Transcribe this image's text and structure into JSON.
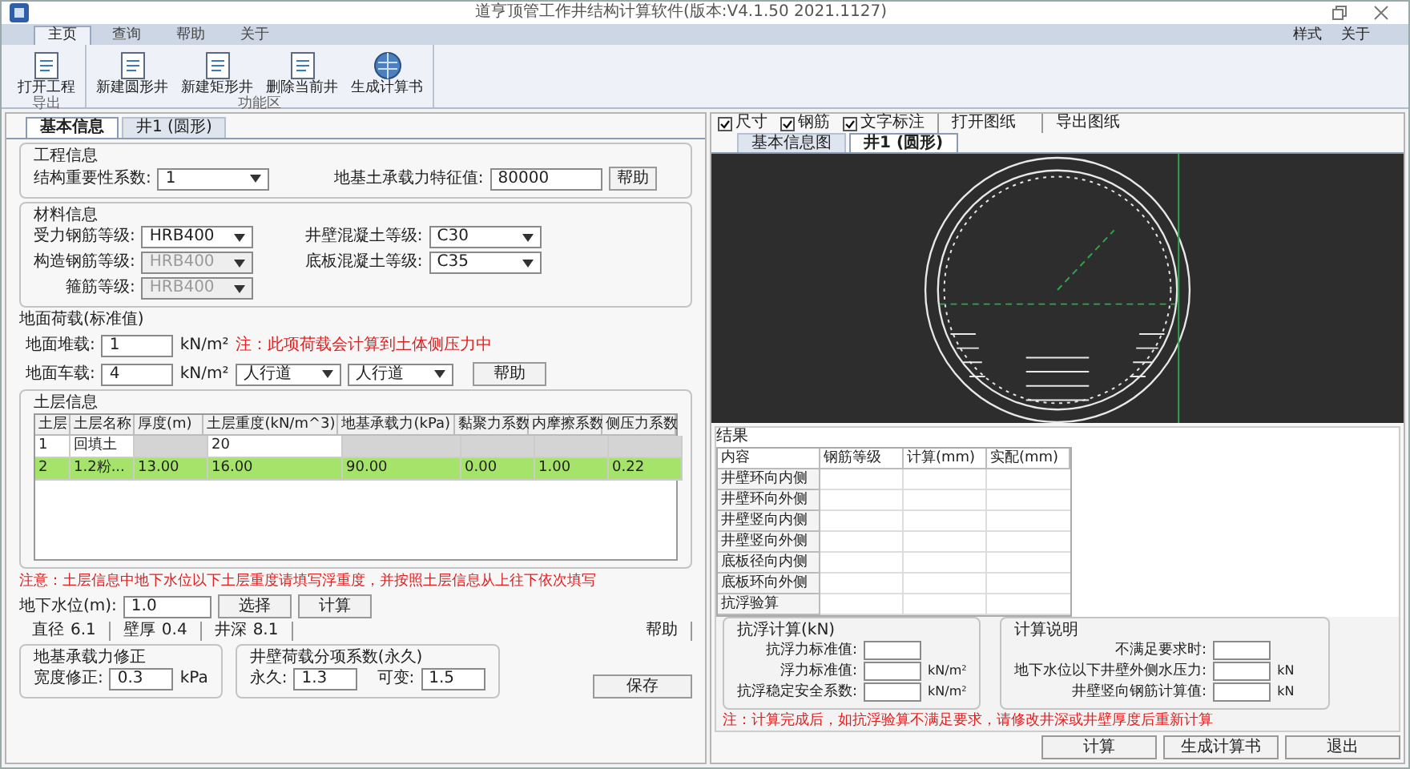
{
  "window": {
    "title": "道亨顶管工作井结构计算软件(版本:V4.1.50 2021.1127)"
  },
  "menu": {
    "tabs": [
      {
        "label": "主页",
        "selected": true
      },
      {
        "label": "查询",
        "selected": false
      },
      {
        "label": "帮助",
        "selected": false
      },
      {
        "label": "关于",
        "selected": false
      }
    ],
    "links": [
      "样式",
      "关于"
    ]
  },
  "ribbon": {
    "groups": [
      {
        "label": "导出",
        "buttons": [
          {
            "label": "打开工程",
            "kind": "doc"
          }
        ]
      },
      {
        "label": "功能区",
        "buttons": [
          {
            "label": "新建圆形井",
            "kind": "doc"
          },
          {
            "label": "新建矩形井",
            "kind": "doc"
          },
          {
            "label": "删除当前井",
            "kind": "doc"
          },
          {
            "label": "生成计算书",
            "kind": "globe"
          }
        ]
      }
    ]
  },
  "left_tabs": [
    {
      "label": "基本信息",
      "selected": true
    },
    {
      "label": "井1 (圆形)",
      "selected": false
    }
  ],
  "project": {
    "title": "工程信息",
    "fields": [
      {
        "kind": "select",
        "label": "结构重要性系数:",
        "value": "1",
        "disabled": false
      },
      {
        "kind": "input",
        "label": "地基土承载力特征值:",
        "value": "80000",
        "button": "帮助"
      }
    ]
  },
  "materials": {
    "title": "材料信息",
    "left": [
      {
        "kind": "select",
        "label": "受力钢筋等级:",
        "value": "HRB400",
        "disabled": false
      },
      {
        "kind": "select",
        "label": "构造钢筋等级:",
        "value": "HRB400",
        "disabled": true
      },
      {
        "kind": "select",
        "label": "箍筋等级:",
        "value": "HRB400",
        "disabled": true
      }
    ],
    "right": [
      {
        "kind": "select",
        "label": "井壁混凝土等级:",
        "value": "C30",
        "disabled": false
      },
      {
        "kind": "select",
        "label": "底板混凝土等级:",
        "value": "C35",
        "disabled": false
      }
    ]
  },
  "surface_load": {
    "title": "地面荷载(标准值)",
    "rows": [
      {
        "label": "地面堆载:",
        "value": "1",
        "unit": "kN/m²",
        "note": "注：此项荷载会计算到土体侧压力中"
      },
      {
        "label": "地面车载:",
        "value": "4",
        "unit": "kN/m²",
        "selects": [
          "人行道",
          "人行道"
        ],
        "button": "帮助"
      }
    ]
  },
  "soil": {
    "title": "土层信息",
    "columns": [
      "土层",
      "土层名称",
      "厚度(m)",
      "土层重度(kN/m^3)",
      "地基承载力(kPa)",
      "黏聚力系数",
      "内摩擦系数",
      "侧压力系数"
    ],
    "rows": [
      {
        "cells": [
          "1",
          "回填土",
          null,
          "20",
          null,
          null,
          null,
          null
        ],
        "selected": false
      },
      {
        "cells": [
          "2",
          "1.2粉...",
          "13.00",
          "16.00",
          "90.00",
          "0.00",
          "1.00",
          "0.22"
        ],
        "selected": true
      }
    ]
  },
  "soil_note": "注意：土层信息中地下水位以下土层重度请填写浮重度，并按照土层信息从上往下依次填写",
  "water": {
    "label": "地下水位(m):",
    "value": "1.0",
    "buttons": [
      "选择",
      "计算"
    ]
  },
  "dims": {
    "items": [
      {
        "label": "直径",
        "value": "6.1"
      },
      {
        "label": "壁厚",
        "value": "0.4"
      },
      {
        "label": "井深",
        "value": "8.1"
      }
    ],
    "help": "帮助"
  },
  "bearing": {
    "title": "地基承载力修正",
    "label": "宽度修正:",
    "value": "0.3",
    "unit": "kPa"
  },
  "factors": {
    "title": "井壁荷载分项系数(永久)",
    "items": [
      {
        "label": "永久:",
        "value": "1.3"
      },
      {
        "label": "可变:",
        "value": "1.5"
      }
    ]
  },
  "save_button": "保存",
  "view_toolbar": [
    {
      "label": "尺寸",
      "checked": true
    },
    {
      "label": "钢筋",
      "checked": true
    },
    {
      "label": "文字标注",
      "checked": true
    }
  ],
  "view_buttons": [
    "打开图纸",
    "导出图纸"
  ],
  "right_tabs": [
    {
      "label": "基本信息图",
      "selected": false
    },
    {
      "label": "井1 (圆形)",
      "selected": true
    }
  ],
  "results": {
    "title": "结果",
    "columns": [
      "内容",
      "钢筋等级",
      "计算(mm)",
      "实配(mm)"
    ],
    "rows": [
      "井壁环向内侧",
      "井壁环向外侧",
      "井壁竖向内侧",
      "井壁竖向外侧",
      "底板径向内侧",
      "底板环向外侧",
      "抗浮验算"
    ]
  },
  "float_calc": {
    "title": "抗浮计算(kN)",
    "fields": [
      {
        "label": "抗浮力标准值:"
      },
      {
        "label": "浮力标准值:",
        "unit": "kN/m²"
      },
      {
        "label": "抗浮稳定安全系数:",
        "unit": "kN/m²"
      }
    ]
  },
  "notes_calc": {
    "title": "计算说明",
    "fields": [
      {
        "label": "不满足要求时:"
      },
      {
        "label": "地下水位以下井壁外侧水压力:",
        "unit": "kN"
      },
      {
        "label": "井壁竖向钢筋计算值:",
        "unit": "kN"
      }
    ]
  },
  "result_note": "注：计算完成后，如抗浮验算不满足要求，请修改井深或井壁厚度后重新计算",
  "actions": [
    "计算",
    "生成计算书",
    "退出"
  ]
}
